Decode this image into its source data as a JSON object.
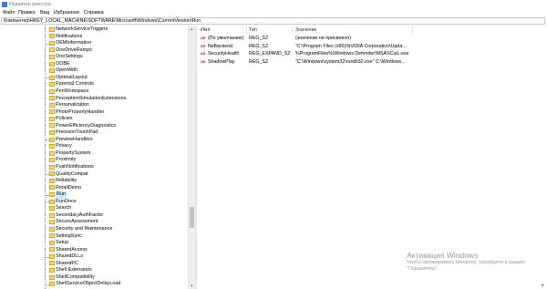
{
  "window": {
    "title": "Редактор реестра"
  },
  "menu": [
    "Файл",
    "Правка",
    "Вид",
    "Избранное",
    "Справка"
  ],
  "address": "Компьютер\\HKEY_LOCAL_MACHINE\\SOFTWARE\\Microsoft\\Windows\\CurrentVersion\\Run",
  "tree": {
    "items": [
      {
        "label": "NetworkServiceTriggers",
        "expandable": true
      },
      {
        "label": "Notifications",
        "expandable": true
      },
      {
        "label": "OEMInformation",
        "expandable": false
      },
      {
        "label": "OneDriveRamps",
        "expandable": true
      },
      {
        "label": "OneSettings",
        "expandable": true
      },
      {
        "label": "OOBE",
        "expandable": true
      },
      {
        "label": "OpenWith",
        "expandable": true
      },
      {
        "label": "OptimalLayout",
        "expandable": false
      },
      {
        "label": "Parental Controls",
        "expandable": true
      },
      {
        "label": "PenWorkspace",
        "expandable": true
      },
      {
        "label": "PerceptionSimulationExtensions",
        "expandable": true
      },
      {
        "label": "Personalization",
        "expandable": true
      },
      {
        "label": "PhotoPropertyHandler",
        "expandable": true
      },
      {
        "label": "Policies",
        "expandable": true
      },
      {
        "label": "PowerEfficiencyDiagnostics",
        "expandable": true
      },
      {
        "label": "PrecisionTouchPad",
        "expandable": true
      },
      {
        "label": "PreviewHandlers",
        "expandable": false
      },
      {
        "label": "Privacy",
        "expandable": true
      },
      {
        "label": "PropertySystem",
        "expandable": true
      },
      {
        "label": "Proximity",
        "expandable": true
      },
      {
        "label": "PushNotifications",
        "expandable": true
      },
      {
        "label": "QualityCompat",
        "expandable": false
      },
      {
        "label": "Reliability",
        "expandable": true
      },
      {
        "label": "RetailDemo",
        "expandable": true
      },
      {
        "label": "Run",
        "expandable": false,
        "selected": true
      },
      {
        "label": "RunOnce",
        "expandable": false
      },
      {
        "label": "Search",
        "expandable": true
      },
      {
        "label": "SecondaryAuthFactor",
        "expandable": true
      },
      {
        "label": "SecureAssessment",
        "expandable": true
      },
      {
        "label": "Security and Maintenance",
        "expandable": true
      },
      {
        "label": "SettingSync",
        "expandable": true
      },
      {
        "label": "Setup",
        "expandable": true
      },
      {
        "label": "SharedAccess",
        "expandable": true
      },
      {
        "label": "SharedDLLs",
        "expandable": false
      },
      {
        "label": "SharedPC",
        "expandable": true
      },
      {
        "label": "Shell Extensions",
        "expandable": true
      },
      {
        "label": "ShellCompatibility",
        "expandable": true
      },
      {
        "label": "ShellServiceObjectDelayLoad",
        "expandable": false
      }
    ]
  },
  "values": {
    "columns": [
      "Имя",
      "Тип",
      "Значение"
    ],
    "rows": [
      {
        "name": "(По умолчанию)",
        "type": "REG_SZ",
        "value": "(значение не присвоено)"
      },
      {
        "name": "NvBackend",
        "type": "REG_SZ",
        "value": "\"C:\\Program Files (x86)\\NVIDIA Corporation\\Upda..."
      },
      {
        "name": "SecurityHealth",
        "type": "REG_EXPAND_SZ",
        "value": "%ProgramFiles%\\Windows Defender\\MSASCuiL.exe"
      },
      {
        "name": "ShadowPlay",
        "type": "REG_SZ",
        "value": "\"C:\\Windows\\system32\\rundll32.exe\" C:\\Windows..."
      }
    ]
  },
  "watermark": {
    "title": "Активация Windows",
    "text": "Чтобы активировать Windows, перейдите в раздел \"Параметры\"."
  },
  "colors": {
    "selection": "#cce8ff",
    "folder": "#f6d36b",
    "reg_icon": "#c0392b"
  }
}
